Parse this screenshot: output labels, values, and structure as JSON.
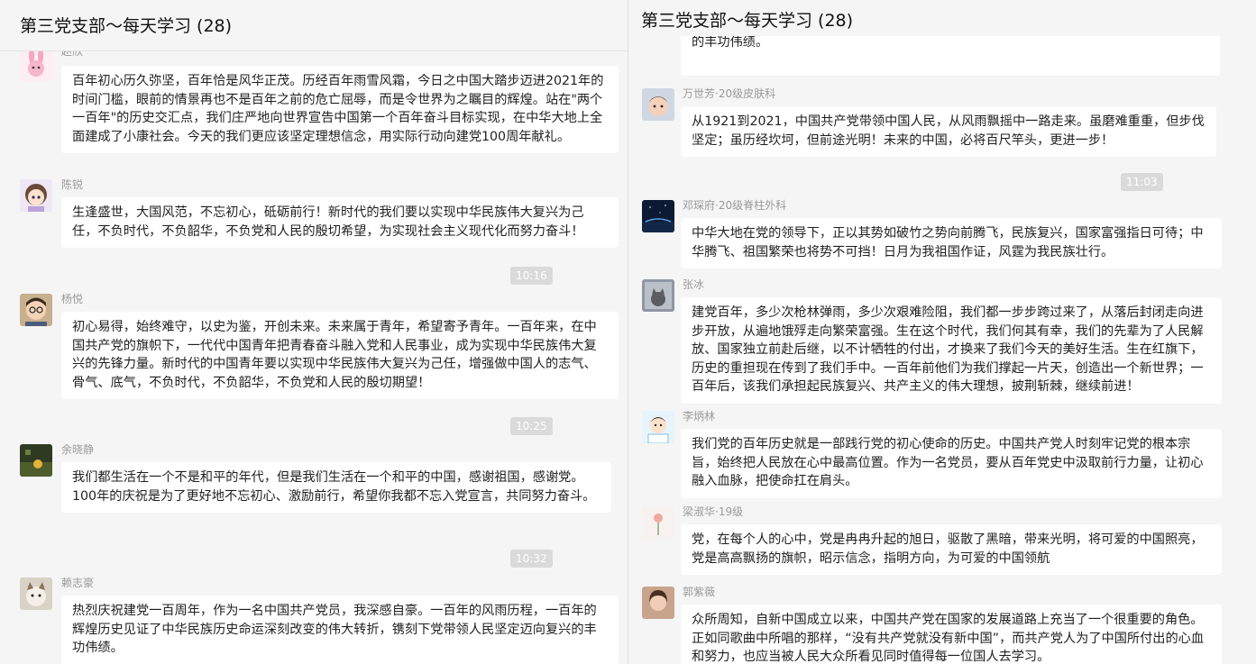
{
  "window": {
    "title": "第三党支部～每天学习 (28)"
  },
  "left_panel": {
    "title": "第三党支部～每天学习 (28)",
    "messages": [
      {
        "sender": "赵欣",
        "text": "百年初心历久弥坚，百年恰是风华正茂。历经百年雨雪风霜，今日之中国大踏步迈进2021年的时间门槛，眼前的情景再也不是百年之前的危亡屈辱，而是令世界为之瞩目的辉煌。站在\"两个一百年\"的历史交汇点，我们庄严地向世界宣告中国第一个百年奋斗目标实现，在中华大地上全面建成了小康社会。今天的我们更应该坚定理想信念，用实际行动向建党100周年献礼。"
      },
      {
        "sender": "陈锐",
        "text": "生逢盛世，大国风范，不忘初心，砥砺前行！新时代的我们要以实现中华民族伟大复兴为己任，不负时代，不负韶华，不负党和人民的殷切希望，为实现社会主义现代化而努力奋斗！"
      },
      {
        "time": "10:16"
      },
      {
        "sender": "杨悦",
        "text": "初心易得，始终难守，以史为鉴，开创未来。未来属于青年，希望寄予青年。一百年来，在中国共产党的旗帜下，一代代中国青年把青春奋斗融入党和人民事业，成为实现中华民族伟大复兴的先锋力量。新时代的中国青年要以实现中华民族伟大复兴为己任，增强做中国人的志气、骨气、底气，不负时代，不负韶华，不负党和人民的殷切期望！"
      },
      {
        "time": "10:25"
      },
      {
        "sender": "余晓静",
        "text": "我们都生活在一个不是和平的年代，但是我们生活在一个和平的中国，感谢祖国，感谢党。100年的庆祝是为了更好地不忘初心、激励前行，希望你我都不忘入党宣言，共同努力奋斗。"
      },
      {
        "time": "10:32"
      },
      {
        "sender": "赖志豪",
        "text": "热烈庆祝建党一百周年，作为一名中国共产党员，我深感自豪。一百年的风雨历程，一百年的辉煌历史见证了中华民族历史命运深刻改变的伟大转折，镌刻下党带领人民坚定迈向复兴的丰功伟绩。"
      }
    ]
  },
  "right_panel": {
    "title": "第三党支部～每天学习 (28)",
    "messages": [
      {
        "sender": "",
        "text": "的辉煌历史见证了中华民族历史命运深刻改变的伟大转折，镌刻下党带领人民坚定迈向复兴的丰功伟绩。"
      },
      {
        "sender": "万世芳·20级皮肤科",
        "text": "从1921到2021，中国共产党带领中国人民，从风雨飘摇中一路走来。虽磨难重重，但步伐坚定；虽历经坎坷，但前途光明！未来的中国，必将百尺竿头，更进一步！"
      },
      {
        "time": "11:03"
      },
      {
        "sender": "邓琛府·20级脊柱外科",
        "text": "中华大地在党的领导下，正以其势如破竹之势向前腾飞，民族复兴，国家富强指日可待；中华腾飞、祖国繁荣也将势不可挡！日月为我祖国作证，风霆为我民族壮行。"
      },
      {
        "sender": "张冰",
        "text": "建党百年，多少次枪林弹雨，多少次艰难险阻，我们都一步步跨过来了，从落后封闭走向进步开放，从遍地饿殍走向繁荣富强。生在这个时代，我们何其有幸，我们的先辈为了人民解放、国家独立前赴后继，以不计牺牲的付出，才换来了我们今天的美好生活。生在红旗下，历史的重担现在传到了我们手中。一百年前他们为我们撑起一片天，创造出一个新世界；一百年后，该我们承担起民族复兴、共产主义的伟大理想，披荆斩棘，继续前进！"
      },
      {
        "sender": "李炳林",
        "text": "我们党的百年历史就是一部践行党的初心使命的历史。中国共产党人时刻牢记党的根本宗旨，始终把人民放在心中最高位置。作为一名党员，要从百年党史中汲取前行力量，让初心融入血脉，把使命扛在肩头。"
      },
      {
        "sender": "梁淑华·19级",
        "text": "党，在每个人的心中，党是冉冉升起的旭日，驱散了黑暗，带来光明，将可爱的中国照亮，党是高高飘扬的旗帜，昭示信念，指明方向，为可爱的中国领航"
      },
      {
        "sender": "郭紫薇",
        "text": " 众所周知，自新中国成立以来，中国共产党在国家的发展道路上充当了一个很重要的角色。正如同歌曲中所唱的那样，“没有共产党就没有新中国”，而共产党人为了中国所付出的心血和努力，也应当被人民大众所看见同时值得每一位国人去学习。"
      }
    ]
  },
  "avatars": [
    "rabbit-avatar",
    "anime-girl-avatar",
    "cartoon-glasses-avatar",
    "nature-photo-avatar",
    "cat-avatar",
    "child-photo-avatar",
    "night-sky-avatar",
    "cat-window-avatar",
    "doctor-cartoon-avatar",
    "flower-avatar",
    "portrait-avatar"
  ]
}
